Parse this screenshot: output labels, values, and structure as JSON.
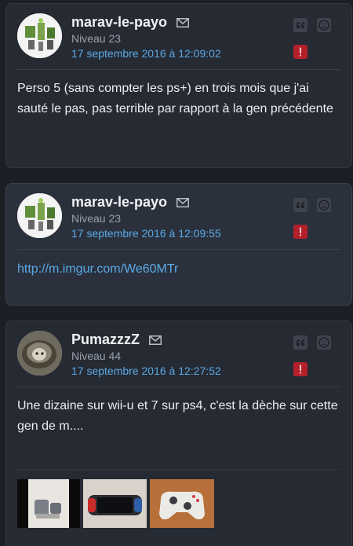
{
  "posts": [
    {
      "author": "marav-le-payo",
      "level": "Niveau 23",
      "date": "17 septembre 2016 à 12:09:02",
      "content": "Perso 5 (sans compter les ps+) en trois mois que j'ai sauté le pas, pas terrible par rapport à la gen précédente"
    },
    {
      "author": "marav-le-payo",
      "level": "Niveau 23",
      "date": "17 septembre 2016 à 12:09:55",
      "content": "http://m.imgur.com/We60MTr"
    },
    {
      "author": "PumazzzZ",
      "level": "Niveau 44",
      "date": "17 septembre 2016 à 12:27:52",
      "content": "Une dizaine sur wii-u et 7 sur ps4, c'est la dèche sur cette gen de m...."
    }
  ],
  "icons": {
    "mail": "envelope-icon",
    "quote": "quote-icon",
    "dislike": "frown-icon",
    "alert": "alert-icon"
  },
  "colors": {
    "background": "#1c1f26",
    "card": "#262a33",
    "card_alt": "#2b313c",
    "link": "#5aa9e6",
    "alert": "#b3202a"
  }
}
